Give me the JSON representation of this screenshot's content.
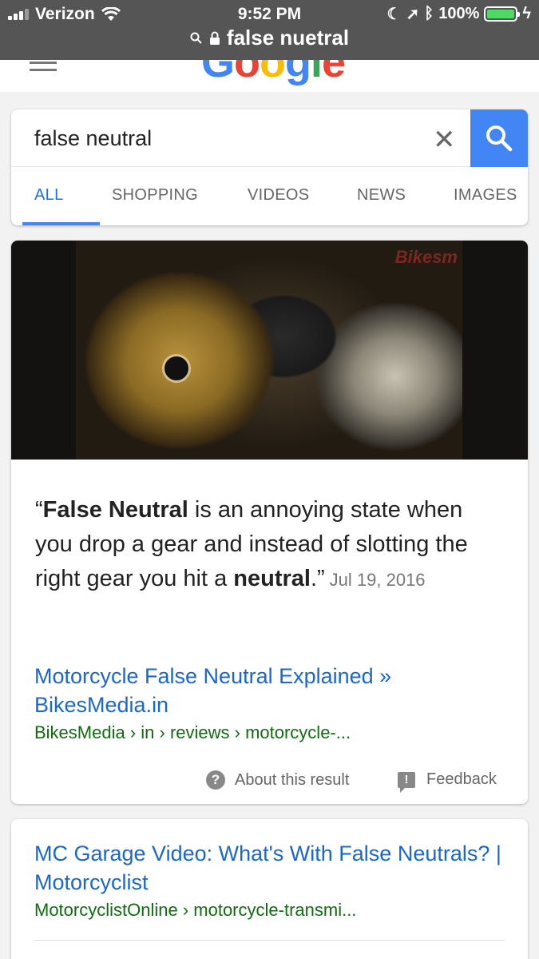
{
  "status_bar": {
    "carrier": "Verizon",
    "time": "9:52 PM",
    "battery": "100%",
    "url": "false nuetral"
  },
  "header": {
    "logo_text": "Google"
  },
  "search": {
    "query": "false neutral",
    "tabs": [
      "ALL",
      "SHOPPING",
      "VIDEOS",
      "NEWS",
      "IMAGES"
    ],
    "active_tab": "ALL"
  },
  "featured_snippet": {
    "image_watermark": "Bikesm",
    "text_bold_1": "False Neutral",
    "text_1": " is an annoying state when you drop a gear and instead of slotting the right gear you hit a ",
    "text_bold_2": "neutral",
    "quote_open": "“",
    "quote_close": ".”",
    "date": "Jul 19, 2016",
    "link_title": "Motorcycle False Neutral Explained » BikesMedia.in",
    "link_cite": "BikesMedia › in › reviews › motorcycle-...",
    "about_label": "About this result",
    "feedback_label": "Feedback"
  },
  "result_2": {
    "title": "MC Garage Video: What's With False Neutrals? | Motorcyclist",
    "cite": "MotorcyclistOnline › motorcycle-transmi..."
  },
  "colors": {
    "status_bar_bg": "#555555",
    "link_blue": "#1967d2",
    "cite_green": "#0e6e0e",
    "search_button": "#4285f4"
  }
}
